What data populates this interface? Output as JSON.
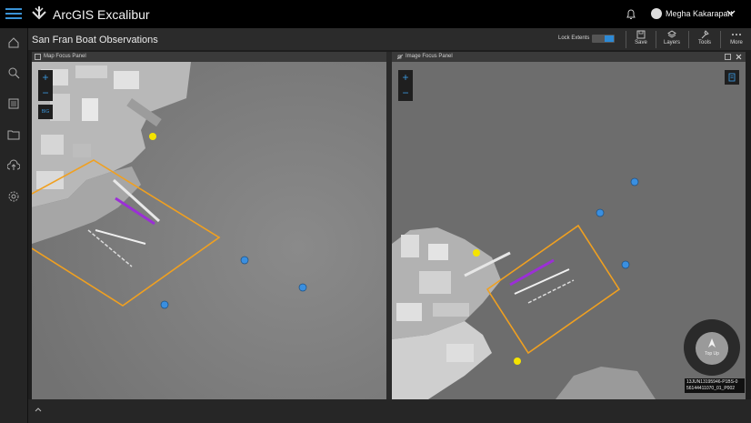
{
  "app": {
    "title": "ArcGIS Excalibur"
  },
  "user": {
    "name": "Megha Kakarapart"
  },
  "header": {
    "page_title": "San Fran Boat Observations",
    "lock_extents_label": "Lock Extents",
    "lock_extents_on": true,
    "tools": [
      {
        "label": "Save",
        "icon": "save-icon"
      },
      {
        "label": "Layers",
        "icon": "layers-icon"
      },
      {
        "label": "Tools",
        "icon": "tools-icon"
      },
      {
        "label": "More",
        "icon": "more-icon"
      }
    ]
  },
  "sidenav": {
    "icons": [
      "home-icon",
      "search-icon",
      "library-icon",
      "folder-icon",
      "upload-icon",
      "settings-icon"
    ]
  },
  "map_panel": {
    "title": "Map Focus Panel",
    "zoom_in": "+",
    "zoom_out": "−",
    "badge": "BIG"
  },
  "image_panel": {
    "title": "Image Focus Panel",
    "zoom_in": "+",
    "zoom_out": "−",
    "compass_label": "Top Up",
    "image_id_line1": "13JUN13195946-P1BS-0",
    "image_id_line2": "56144411070_01_P002"
  },
  "colors": {
    "accent": "#2d8ad6",
    "footprint": "#f0a020",
    "observation_yellow": "#f5e400",
    "observation_blue": "#3a8fe0",
    "vessel": "#9b2fd6"
  }
}
